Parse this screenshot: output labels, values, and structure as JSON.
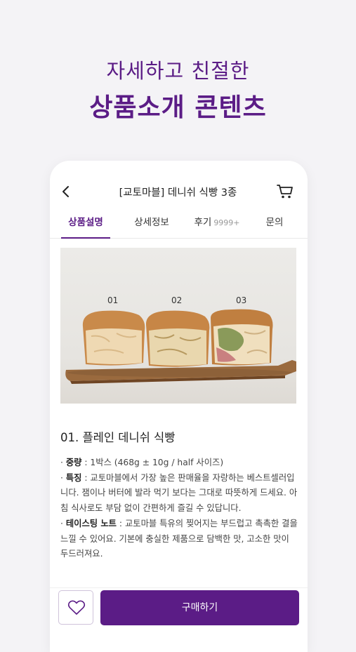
{
  "promo": {
    "subtitle": "자세하고 친절한",
    "title": "상품소개 콘텐츠"
  },
  "header": {
    "title": "[교토마블] 데니쉬 식빵 3종"
  },
  "tabs": [
    {
      "label": "상품설명",
      "active": true
    },
    {
      "label": "상세정보"
    },
    {
      "label": "후기",
      "count": "9999+"
    },
    {
      "label": "문의"
    }
  ],
  "photo": {
    "labels": [
      "01",
      "02",
      "03"
    ]
  },
  "product": {
    "title": "01. 플레인 데니쉬 식빵",
    "weight_label": "중량",
    "weight_value": " : 1박스 (468g ± 10g / half 사이즈)",
    "feature_label": "특징",
    "feature_value": " : 교토마블에서 가장 높은 판매율을 자랑하는 베스트셀러입니다. 잼이나 버터에 발라 먹기 보다는 그대로 따뜻하게 드세요. 아침 식사로도 부담 없이 간편하게 즐길 수 있답니다.",
    "tasting_label": "테이스팅 노트",
    "tasting_value": " : 교토마블 특유의 찢어지는 부드럽고 촉촉한 결을 느낄 수 있어요. 기본에 충실한 제품으로 담백한 맛, 고소한 맛이 두드러져요."
  },
  "bottom": {
    "buy_label": "구매하기"
  },
  "colors": {
    "brand": "#5b1c86"
  }
}
